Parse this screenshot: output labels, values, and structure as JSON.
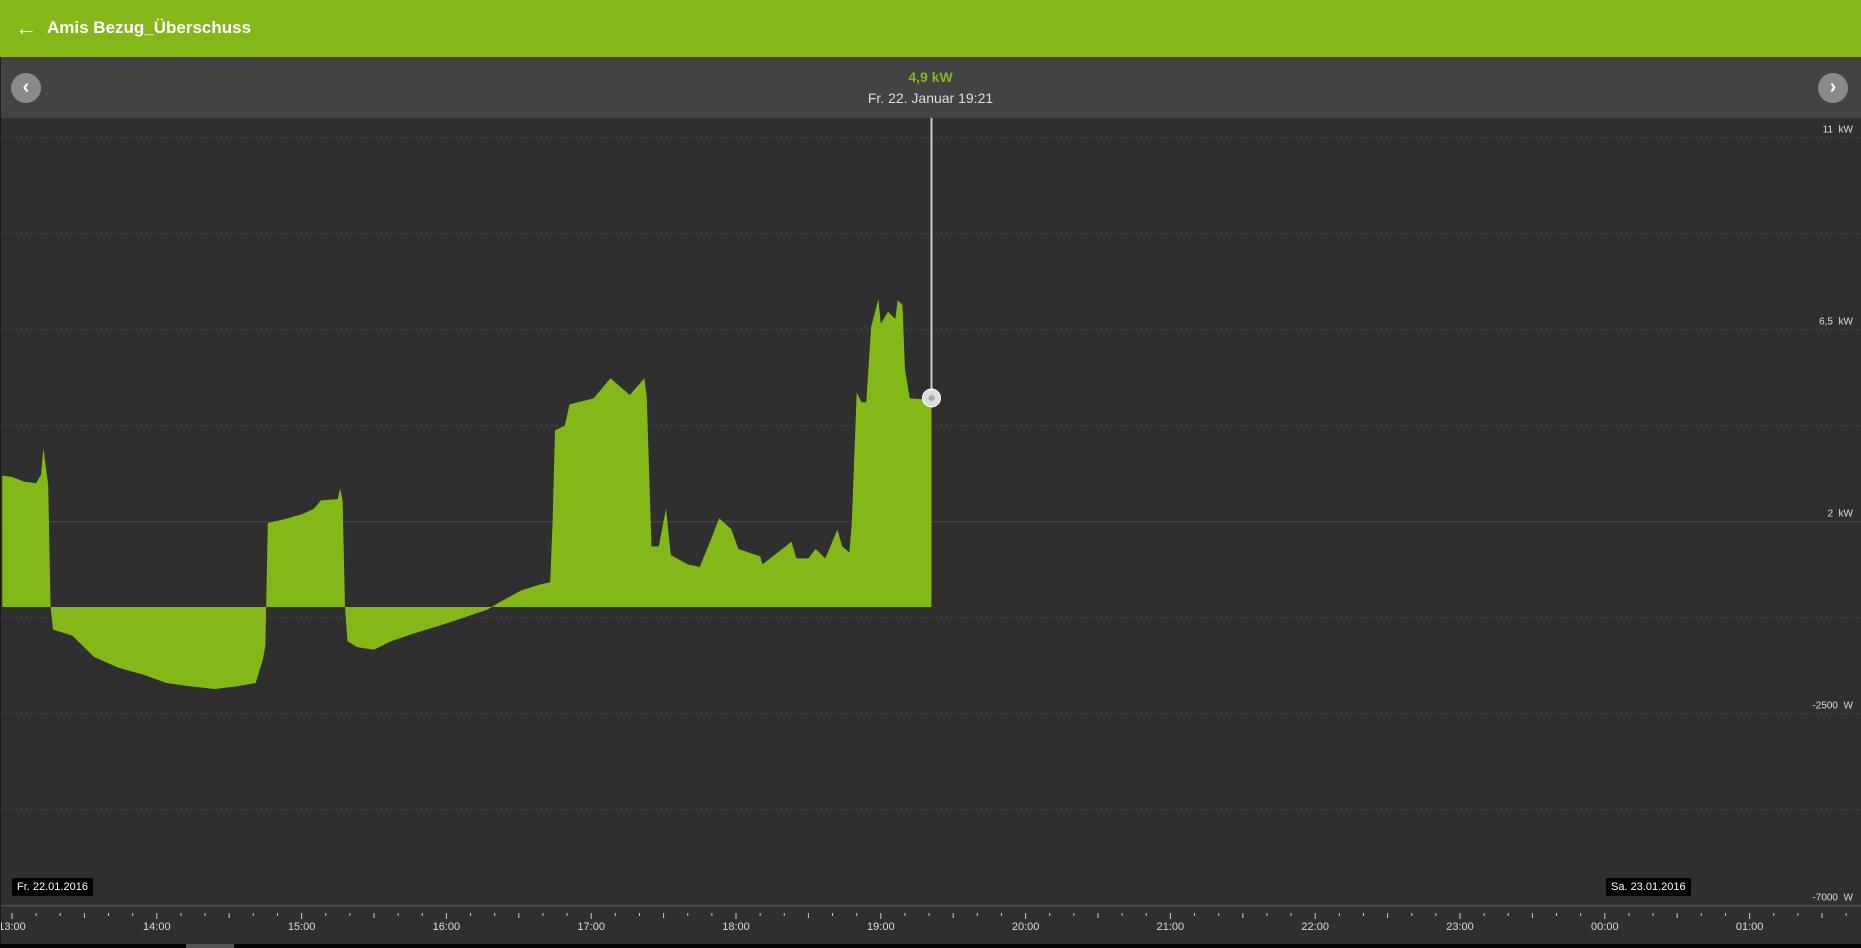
{
  "header": {
    "title": "Amis Bezug_Überschuss",
    "back_icon": "arrow-left-icon"
  },
  "subheader": {
    "value": "4,9 kW",
    "datetime": "Fr. 22. Januar 19:21",
    "prev_icon": "chevron-left-icon",
    "next_icon": "chevron-right-icon"
  },
  "colors": {
    "accent": "#84b818",
    "background": "#2f2f2f",
    "subheader": "#434343"
  },
  "chart_data": {
    "type": "area",
    "ylim_kW": [
      -7,
      11
    ],
    "y_gridlines_kW": [
      -7,
      -4.75,
      -2.5,
      -0.25,
      2,
      4.25,
      6.5,
      8.75,
      11
    ],
    "y_tick_labels": [
      {
        "value": 11,
        "label": "11  kW"
      },
      {
        "value": 6.5,
        "label": "6,5  kW"
      },
      {
        "value": 2,
        "label": "2  kW"
      },
      {
        "value": -2.5,
        "label": "-2500  W"
      },
      {
        "value": -7,
        "label": "-7000  W"
      }
    ],
    "x_tick_labels": [
      "13:00",
      "14:00",
      "15:00",
      "16:00",
      "17:00",
      "18:00",
      "19:00",
      "20:00",
      "21:00",
      "22:00",
      "23:00",
      "00:00",
      "01:00"
    ],
    "date_labels": [
      {
        "label": "Fr. 22.01.2016"
      },
      {
        "label": "Sa. 23.01.2016"
      }
    ],
    "cursor": {
      "time": "19:21",
      "value_kW": 4.9
    },
    "series": [
      {
        "points": [
          [
            "12:56",
            3.08
          ],
          [
            "13:00",
            3.05
          ],
          [
            "13:05",
            2.94
          ],
          [
            "13:10",
            2.9
          ],
          [
            "13:12",
            3.1
          ],
          [
            "13:13",
            3.72
          ],
          [
            "13:15",
            2.86
          ],
          [
            "13:16",
            0
          ],
          [
            "13:17",
            -0.53
          ],
          [
            "13:25",
            -0.67
          ],
          [
            "13:34",
            -1.17
          ],
          [
            "13:44",
            -1.42
          ],
          [
            "13:54",
            -1.58
          ],
          [
            "14:04",
            -1.78
          ],
          [
            "14:14",
            -1.86
          ],
          [
            "14:24",
            -1.92
          ],
          [
            "14:33",
            -1.86
          ],
          [
            "14:41",
            -1.78
          ],
          [
            "14:44",
            -1.22
          ],
          [
            "14:45",
            -0.9
          ],
          [
            "14:46",
            1.97
          ],
          [
            "14:53",
            2.06
          ],
          [
            "15:00",
            2.17
          ],
          [
            "15:05",
            2.3
          ],
          [
            "15:08",
            2.5
          ],
          [
            "15:15",
            2.53
          ],
          [
            "15:16",
            2.78
          ],
          [
            "15:17",
            2.5
          ],
          [
            "15:18",
            0
          ],
          [
            "15:19",
            -0.8
          ],
          [
            "15:23",
            -0.94
          ],
          [
            "15:30",
            -1.0
          ],
          [
            "15:37",
            -0.8
          ],
          [
            "15:47",
            -0.61
          ],
          [
            "15:57",
            -0.44
          ],
          [
            "16:07",
            -0.25
          ],
          [
            "16:17",
            -0.06
          ],
          [
            "16:22",
            0.11
          ],
          [
            "16:31",
            0.39
          ],
          [
            "16:39",
            0.53
          ],
          [
            "16:43",
            0.58
          ],
          [
            "16:44",
            2.0
          ],
          [
            "16:45",
            4.14
          ],
          [
            "16:49",
            4.25
          ],
          [
            "16:51",
            4.75
          ],
          [
            "17:01",
            4.89
          ],
          [
            "17:08",
            5.36
          ],
          [
            "17:16",
            4.97
          ],
          [
            "17:22",
            5.36
          ],
          [
            "17:23",
            4.94
          ],
          [
            "17:25",
            1.42
          ],
          [
            "17:28",
            1.42
          ],
          [
            "17:31",
            2.31
          ],
          [
            "17:33",
            1.22
          ],
          [
            "17:40",
            1.0
          ],
          [
            "17:45",
            0.94
          ],
          [
            "17:50",
            1.64
          ],
          [
            "17:53",
            2.08
          ],
          [
            "17:58",
            1.83
          ],
          [
            "18:01",
            1.36
          ],
          [
            "18:10",
            1.19
          ],
          [
            "18:11",
            1.0
          ],
          [
            "18:23",
            1.53
          ],
          [
            "18:25",
            1.14
          ],
          [
            "18:30",
            1.14
          ],
          [
            "18:33",
            1.36
          ],
          [
            "18:37",
            1.14
          ],
          [
            "18:42",
            1.81
          ],
          [
            "18:44",
            1.42
          ],
          [
            "18:47",
            1.28
          ],
          [
            "18:48",
            1.97
          ],
          [
            "18:50",
            5.03
          ],
          [
            "18:52",
            4.8
          ],
          [
            "18:54",
            4.8
          ],
          [
            "18:56",
            6.56
          ],
          [
            "18:59",
            7.22
          ],
          [
            "19:00",
            6.64
          ],
          [
            "19:03",
            6.92
          ],
          [
            "19:06",
            6.75
          ],
          [
            "19:07",
            7.19
          ],
          [
            "19:09",
            7.08
          ],
          [
            "19:10",
            5.58
          ],
          [
            "19:12",
            4.89
          ],
          [
            "19:21",
            4.86
          ]
        ]
      }
    ]
  }
}
